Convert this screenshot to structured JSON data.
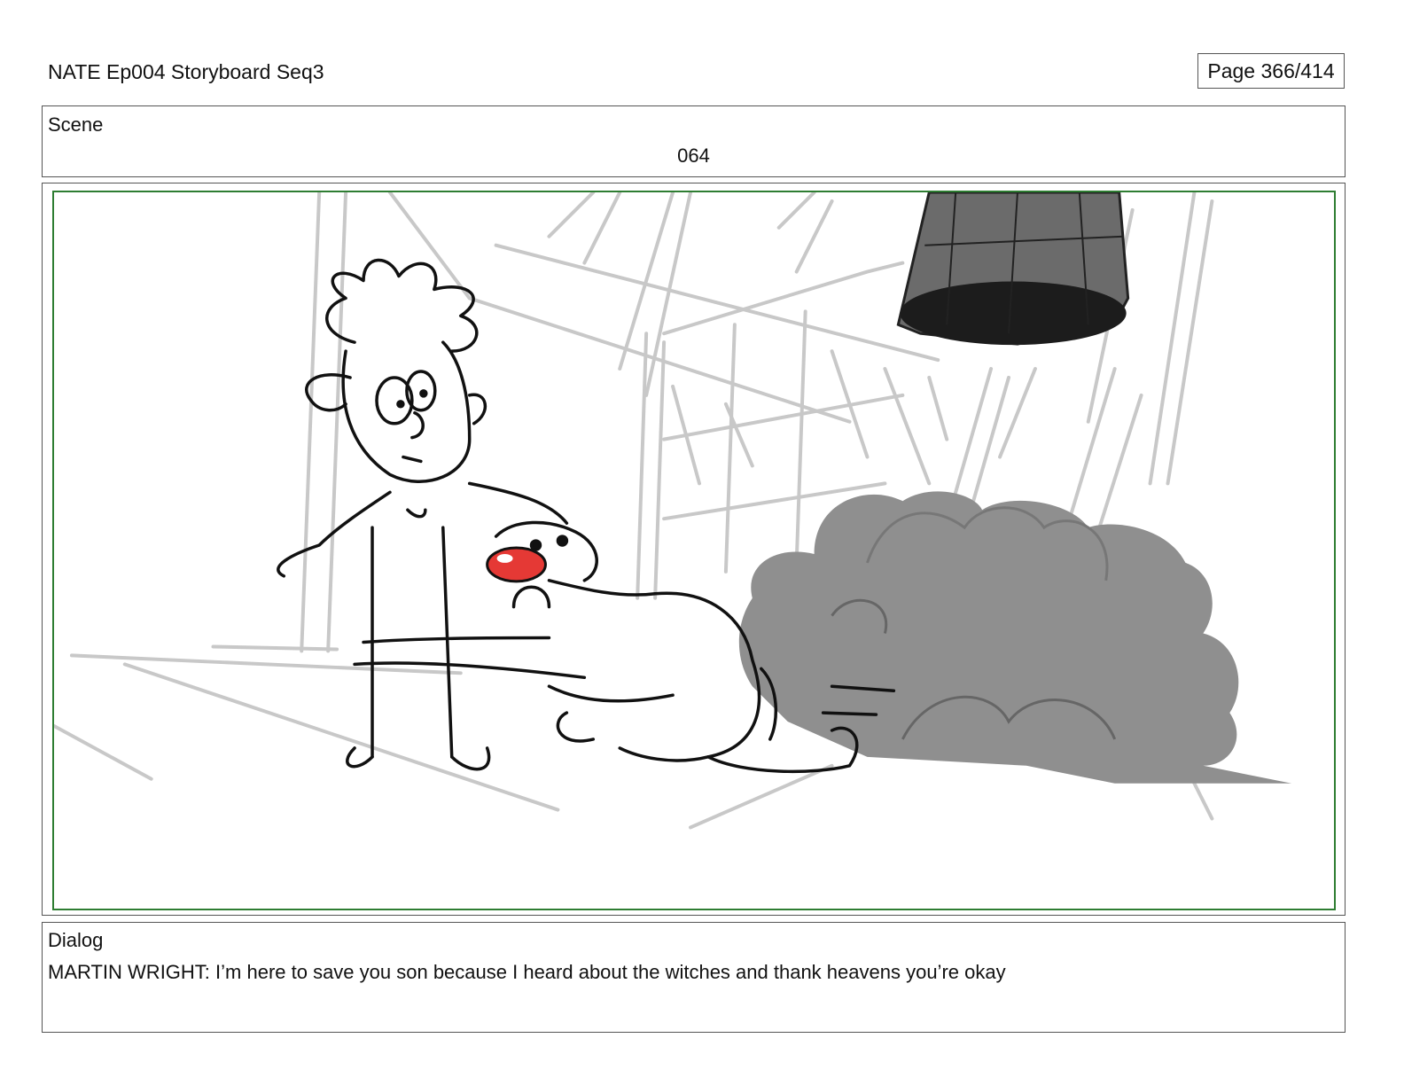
{
  "header": {
    "title": "NATE Ep004 Storyboard Seq3",
    "page": "Page 366/414"
  },
  "scene": {
    "label": "Scene",
    "number": "064"
  },
  "panel": {
    "frame_color": "#2e7d32",
    "highlight_color": "#e53935"
  },
  "dialog": {
    "label": "Dialog",
    "text": "MARTIN WRIGHT: I’m here to save you son because I heard about the witches and thank heavens you’re okay"
  }
}
